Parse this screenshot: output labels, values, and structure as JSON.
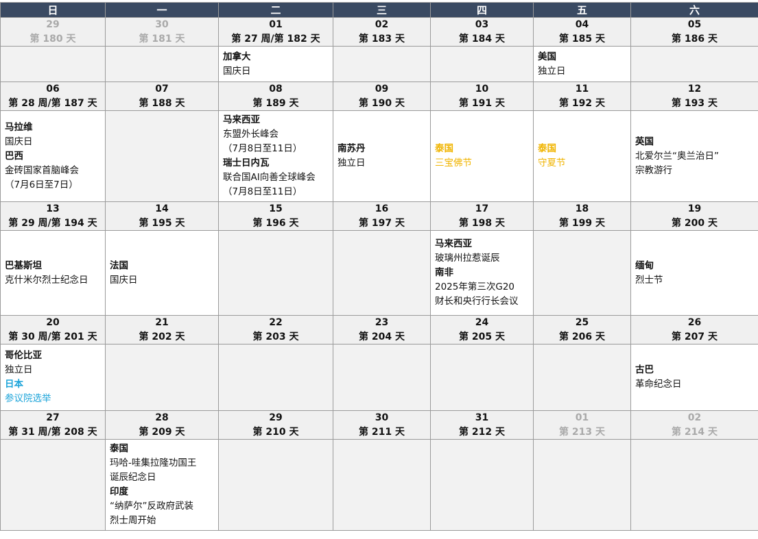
{
  "header": {
    "days": [
      "日",
      "一",
      "二",
      "三",
      "四",
      "五",
      "六"
    ]
  },
  "weeks": [
    {
      "dates": [
        {
          "num": "29",
          "label": "第 180 天",
          "muted": true
        },
        {
          "num": "30",
          "label": "第 181 天",
          "muted": true
        },
        {
          "num": "01",
          "label": "第 27 周/第 182 天"
        },
        {
          "num": "02",
          "label": "第 183 天"
        },
        {
          "num": "03",
          "label": "第 184 天"
        },
        {
          "num": "04",
          "label": "第 185 天"
        },
        {
          "num": "05",
          "label": "第 186 天"
        }
      ],
      "events": [
        null,
        null,
        [
          {
            "country": "加拿大",
            "lines": [
              "国庆日"
            ]
          }
        ],
        null,
        null,
        [
          {
            "country": "美国",
            "lines": [
              "独立日"
            ]
          }
        ],
        null
      ]
    },
    {
      "dates": [
        {
          "num": "06",
          "label": "第 28 周/第 187 天"
        },
        {
          "num": "07",
          "label": "第 188 天"
        },
        {
          "num": "08",
          "label": "第 189 天"
        },
        {
          "num": "09",
          "label": "第 190 天"
        },
        {
          "num": "10",
          "label": "第 191 天"
        },
        {
          "num": "11",
          "label": "第 192 天"
        },
        {
          "num": "12",
          "label": "第 193 天"
        }
      ],
      "events": [
        [
          {
            "country": "马拉维",
            "lines": [
              "国庆日"
            ]
          },
          {
            "country": "巴西",
            "lines": [
              "金砖国家首脑峰会",
              "（7月6日至7日）"
            ]
          }
        ],
        null,
        [
          {
            "country": "马来西亚",
            "lines": [
              "东盟外长峰会",
              "（7月8日至11日）"
            ]
          },
          {
            "country": "瑞士日内瓦",
            "lines": [
              "联合国AI向善全球峰会",
              "（7月8日至11日）"
            ]
          }
        ],
        [
          {
            "country": "南苏丹",
            "lines": [
              "独立日"
            ]
          }
        ],
        [
          {
            "country": "泰国",
            "lines": [
              "三宝佛节"
            ],
            "color": "#f0b400"
          }
        ],
        [
          {
            "country": "泰国",
            "lines": [
              "守夏节"
            ],
            "color": "#f0b400"
          }
        ],
        [
          {
            "country": "英国",
            "lines": [
              "北爱尔兰“奥兰治日”",
              "宗教游行"
            ]
          }
        ]
      ]
    },
    {
      "dates": [
        {
          "num": "13",
          "label": "第 29 周/第 194 天"
        },
        {
          "num": "14",
          "label": "第 195 天"
        },
        {
          "num": "15",
          "label": "第 196 天"
        },
        {
          "num": "16",
          "label": "第 197 天"
        },
        {
          "num": "17",
          "label": "第 198 天"
        },
        {
          "num": "18",
          "label": "第 199 天"
        },
        {
          "num": "19",
          "label": "第 200 天"
        }
      ],
      "events": [
        [
          {
            "country": "巴基斯坦",
            "lines": [
              "克什米尔烈士纪念日"
            ]
          }
        ],
        [
          {
            "country": "法国",
            "lines": [
              "国庆日"
            ]
          }
        ],
        null,
        null,
        [
          {
            "country": "马来西亚",
            "lines": [
              "玻璃州拉惹诞辰"
            ]
          },
          {
            "country": "南非",
            "lines": [
              "2025年第三次G20",
              "财长和央行行长会议"
            ]
          }
        ],
        null,
        [
          {
            "country": "缅甸",
            "lines": [
              "烈士节"
            ]
          }
        ]
      ]
    },
    {
      "dates": [
        {
          "num": "20",
          "label": "第 30 周/第 201 天"
        },
        {
          "num": "21",
          "label": "第 202 天"
        },
        {
          "num": "22",
          "label": "第 203 天"
        },
        {
          "num": "23",
          "label": "第 204 天"
        },
        {
          "num": "24",
          "label": "第 205 天"
        },
        {
          "num": "25",
          "label": "第 206 天"
        },
        {
          "num": "26",
          "label": "第 207 天"
        }
      ],
      "events": [
        [
          {
            "country": "哥伦比亚",
            "lines": [
              "独立日"
            ]
          },
          {
            "country": "日本",
            "lines": [
              "参议院选举"
            ],
            "color": "#1aa3d9"
          }
        ],
        null,
        null,
        null,
        null,
        null,
        [
          {
            "country": "古巴",
            "lines": [
              "革命纪念日"
            ]
          }
        ]
      ]
    },
    {
      "dates": [
        {
          "num": "27",
          "label": "第 31 周/第 208 天"
        },
        {
          "num": "28",
          "label": "第 209 天"
        },
        {
          "num": "29",
          "label": "第 210 天"
        },
        {
          "num": "30",
          "label": "第 211 天"
        },
        {
          "num": "31",
          "label": "第 212 天"
        },
        {
          "num": "01",
          "label": "第 213 天",
          "muted": true
        },
        {
          "num": "02",
          "label": "第 214 天",
          "muted": true
        }
      ],
      "events": [
        null,
        [
          {
            "country": "泰国",
            "lines": [
              "玛哈-哇集拉隆功国王",
              "诞辰纪念日"
            ]
          },
          {
            "country": "印度",
            "lines": [
              "“纳萨尔”反政府武装",
              "烈士周开始"
            ]
          }
        ],
        null,
        null,
        null,
        null,
        null
      ]
    }
  ]
}
